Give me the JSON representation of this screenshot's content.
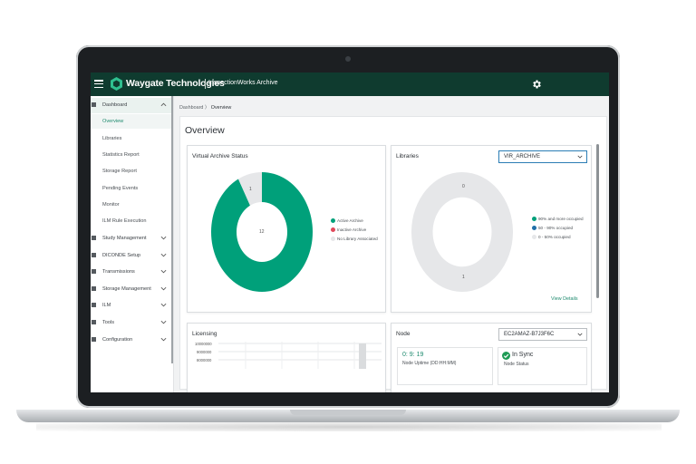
{
  "app": {
    "brand": "Waygate Technologies",
    "product": "InspectionWorks Archive"
  },
  "breadcrumb": {
    "root": "Dashboard",
    "separator": "〉",
    "current": "Overview"
  },
  "page_title": "Overview",
  "sidebar": {
    "items": [
      {
        "label": "Dashboard",
        "icon": "bar-chart-icon",
        "expanded": true
      },
      {
        "label": "Study Management",
        "icon": "study-icon"
      },
      {
        "label": "DICONDE Setup",
        "icon": "setup-icon"
      },
      {
        "label": "Transmissions",
        "icon": "transmission-icon"
      },
      {
        "label": "Storage Management",
        "icon": "storage-icon"
      },
      {
        "label": "ILM",
        "icon": "ilm-icon"
      },
      {
        "label": "Tools",
        "icon": "wrench-icon"
      },
      {
        "label": "Configuration",
        "icon": "config-icon"
      }
    ],
    "dashboard_sub": [
      "Overview",
      "Libraries",
      "Statistics Report",
      "Storage Report",
      "Pending Events",
      "Monitor",
      "ILM Rule Execution"
    ]
  },
  "virtual_archive": {
    "title": "Virtual Archive Status",
    "center_value": "12",
    "small_label": "1",
    "legend": [
      {
        "label": "Active Archive",
        "color": "#00a07a"
      },
      {
        "label": "Inactive Archive",
        "color": "#e0485a"
      },
      {
        "label": "No Library Associated",
        "color": "#e6e7e9"
      }
    ]
  },
  "libraries": {
    "title": "Libraries",
    "selected": "VIR_ARCHIVE",
    "top_label": "0",
    "bottom_label": "1",
    "legend": [
      {
        "label": "90% and more occupied",
        "color": "#00a07a"
      },
      {
        "label": "50 - 90% occupied",
        "color": "#1f6fa8"
      },
      {
        "label": "0 - 50% occupied",
        "color": "#e6e7e9"
      }
    ],
    "link": "View Details"
  },
  "licensing": {
    "title": "Licensing",
    "y_ticks": [
      "10000000",
      "9000000",
      "8000000"
    ]
  },
  "node": {
    "title": "Node",
    "selected": "EC2AMAZ-B7J3F6C",
    "uptime_value": "0: 9: 19",
    "uptime_label": "Node Uptime (DD:HH:MM)",
    "sync_value": "In Sync",
    "sync_label": "Node Status"
  },
  "colors": {
    "topbar": "#0f3b2f",
    "accent": "#00a07a"
  },
  "chart_data": [
    {
      "type": "pie",
      "title": "Virtual Archive Status",
      "categories": [
        "Active Archive",
        "Inactive Archive",
        "No Library Associated"
      ],
      "values": [
        12,
        0,
        1
      ],
      "legend": "right"
    },
    {
      "type": "pie",
      "title": "Libraries",
      "categories": [
        "90% and more occupied",
        "50 - 90% occupied",
        "0 - 50% occupied"
      ],
      "values": [
        0,
        0,
        1
      ],
      "legend": "right"
    }
  ]
}
